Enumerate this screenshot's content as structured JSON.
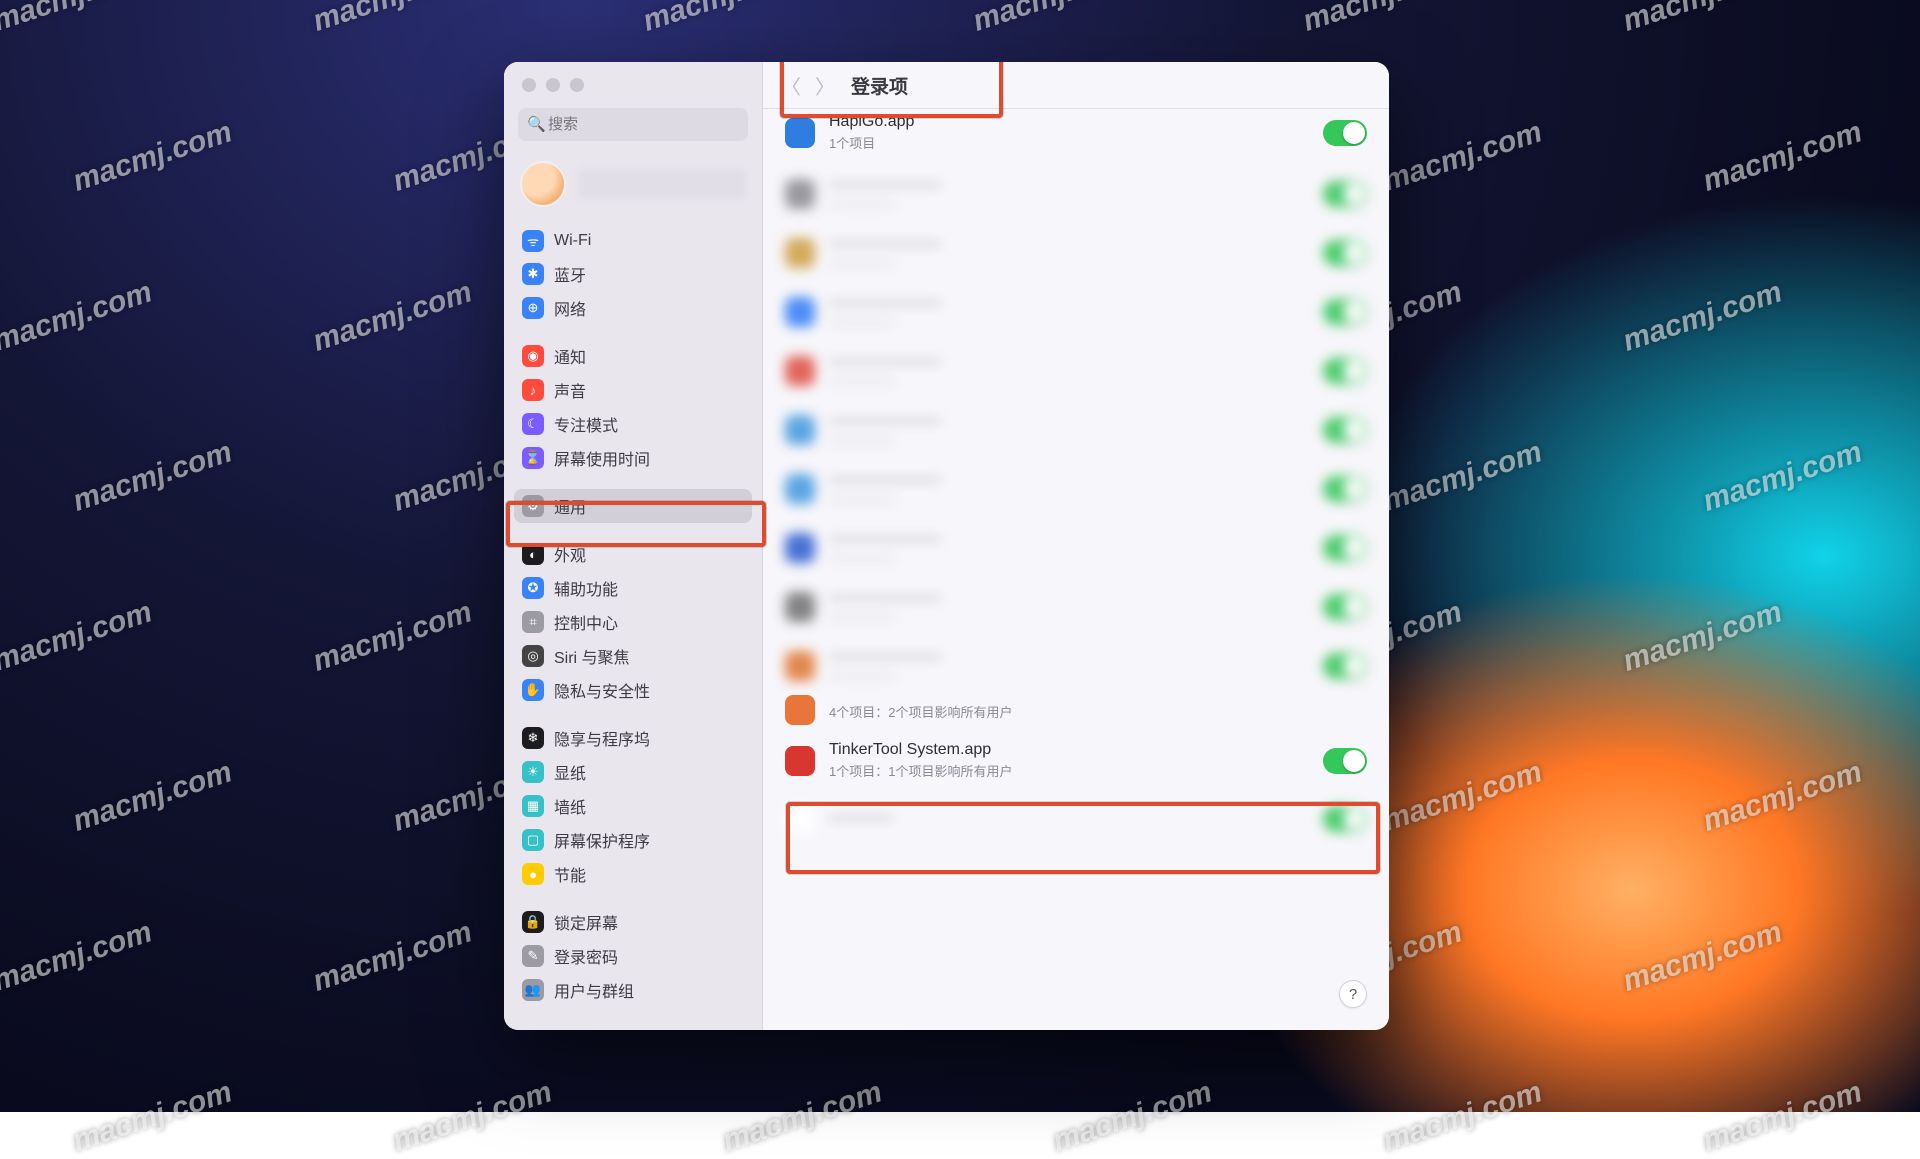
{
  "watermark": "macmj.com",
  "window": {
    "title": "登录项",
    "search_placeholder": "搜索"
  },
  "sidebar": {
    "items": [
      {
        "label": "Wi-Fi",
        "color": "#3a82f7",
        "glyph": "ᯤ"
      },
      {
        "label": "蓝牙",
        "color": "#3a82f7",
        "glyph": "✱"
      },
      {
        "label": "网络",
        "color": "#3a82f7",
        "glyph": "⊕"
      },
      {
        "label": "通知",
        "color": "#ff4b3e",
        "glyph": "◉"
      },
      {
        "label": "声音",
        "color": "#ff4b3e",
        "glyph": "♪"
      },
      {
        "label": "专注模式",
        "color": "#7a5cff",
        "glyph": "☾"
      },
      {
        "label": "屏幕使用时间",
        "color": "#7a5cff",
        "glyph": "⌛"
      },
      {
        "label": "通用",
        "color": "#9c9aa3",
        "glyph": "⚙",
        "selected": true
      },
      {
        "label": "外观",
        "color": "#1c1c1e",
        "glyph": "◐"
      },
      {
        "label": "辅助功能",
        "color": "#3a82f7",
        "glyph": "✪"
      },
      {
        "label": "控制中心",
        "color": "#9c9aa3",
        "glyph": "⌗"
      },
      {
        "label": "Siri 与聚焦",
        "color": "#444",
        "glyph": "◎"
      },
      {
        "label": "隐私与安全性",
        "color": "#3a82f7",
        "glyph": "✋"
      },
      {
        "label": "隐享与程序坞",
        "color": "#1c1c1e",
        "glyph": "❄"
      },
      {
        "label": "显纸",
        "color": "#36c0c7",
        "glyph": "☀"
      },
      {
        "label": "墙纸",
        "color": "#36c0c7",
        "glyph": "▦"
      },
      {
        "label": "屏幕保护程序",
        "color": "#36c0c7",
        "glyph": "▢"
      },
      {
        "label": "节能",
        "color": "#ffcc00",
        "glyph": "●"
      },
      {
        "label": "锁定屏幕",
        "color": "#1c1c1e",
        "glyph": "🔒"
      },
      {
        "label": "登录密码",
        "color": "#9c9aa3",
        "glyph": "✎"
      },
      {
        "label": "用户与群组",
        "color": "#9c9aa3",
        "glyph": "👥"
      }
    ],
    "group_breaks": [
      3,
      7,
      8,
      13,
      18
    ]
  },
  "login_items": {
    "visible_top": {
      "name": "HapiGo.app",
      "sub": "1个项目",
      "icon": "#2f7de0",
      "toggle": true
    },
    "blurred_count": 9,
    "visible_mid_sub": "4个项目：2个项目影响所有用户",
    "highlighted": {
      "name": "TinkerTool System.app",
      "sub": "1个项目：1个项目影响所有用户",
      "icon": "#d8362f",
      "toggle": true
    }
  },
  "help_label": "?"
}
